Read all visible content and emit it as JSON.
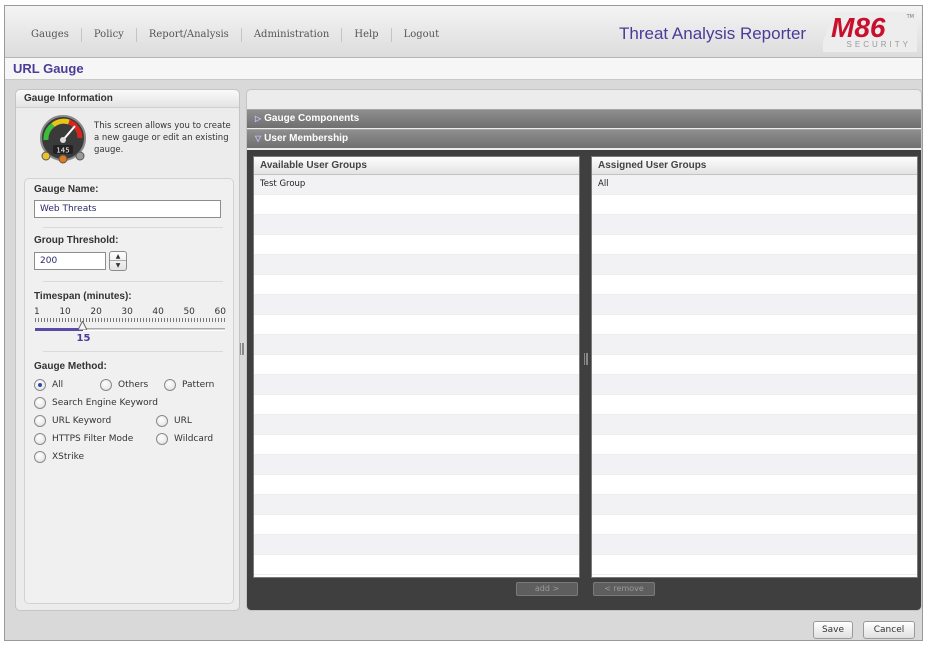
{
  "nav": {
    "items": [
      "Gauges",
      "Policy",
      "Report/Analysis",
      "Administration",
      "Help",
      "Logout"
    ],
    "app_title": "Threat Analysis Reporter",
    "logo_text": "M86",
    "logo_sub": "SECURITY",
    "logo_tm": "TM"
  },
  "page": {
    "title": "URL Gauge"
  },
  "left": {
    "header": "Gauge Information",
    "gauge_icon_value": "145",
    "description": "This screen allows you to create a new gauge or edit an existing gauge.",
    "gauge_name_label": "Gauge Name:",
    "gauge_name_value": "Web Threats",
    "threshold_label": "Group Threshold:",
    "threshold_value": "200",
    "timespan_label": "Timespan (minutes):",
    "timespan_ticks": [
      "1",
      "10",
      "20",
      "30",
      "40",
      "50",
      "60"
    ],
    "timespan_value": "15",
    "timespan_fraction": 0.25,
    "method_label": "Gauge Method:",
    "methods": {
      "all": "All",
      "others": "Others",
      "pattern": "Pattern",
      "search_engine_keyword": "Search Engine Keyword",
      "url_keyword": "URL Keyword",
      "url": "URL",
      "https_filter_mode": "HTTPS Filter Mode",
      "wildcard": "Wildcard",
      "xstrike": "XStrike"
    },
    "selected_method": "All"
  },
  "right": {
    "components_label": "Gauge Components",
    "membership_label": "User Membership",
    "available_header": "Available User Groups",
    "assigned_header": "Assigned User Groups",
    "available_groups": [
      "Test Group"
    ],
    "assigned_groups": [
      "All"
    ],
    "add_label": "add >",
    "remove_label": "< remove"
  },
  "footer": {
    "save_label": "Save",
    "cancel_label": "Cancel"
  },
  "colors": {
    "accent": "#4a3d9a",
    "panel_dark": "#3f3f3f",
    "header_gray": "#7f7f7f",
    "logo_red": "#c8102e"
  }
}
